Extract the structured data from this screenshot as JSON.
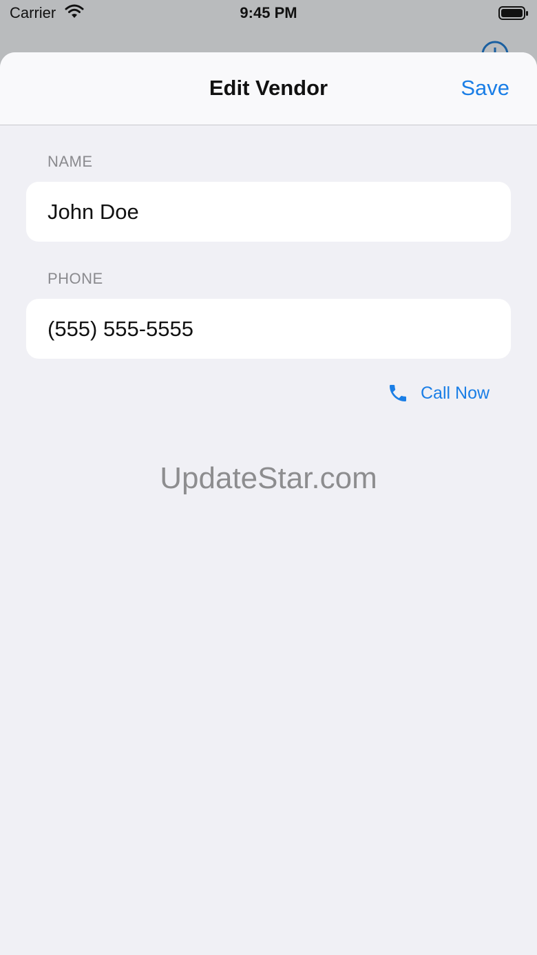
{
  "status_bar": {
    "carrier": "Carrier",
    "time": "9:45 PM",
    "wifi_icon": "wifi-icon",
    "battery_icon": "battery-icon"
  },
  "nav": {
    "title": "Edit Vendor",
    "save_label": "Save"
  },
  "form": {
    "name_header": "NAME",
    "name_value": "John Doe",
    "phone_header": "PHONE",
    "phone_value": "(555) 555-5555",
    "call_label": "Call Now",
    "call_icon": "phone-icon"
  },
  "watermark": "UpdateStar.com",
  "colors": {
    "accent": "#1a7ee6",
    "background": "#f0f0f5",
    "card": "#ffffff",
    "secondary_text": "#8a8a8e"
  }
}
